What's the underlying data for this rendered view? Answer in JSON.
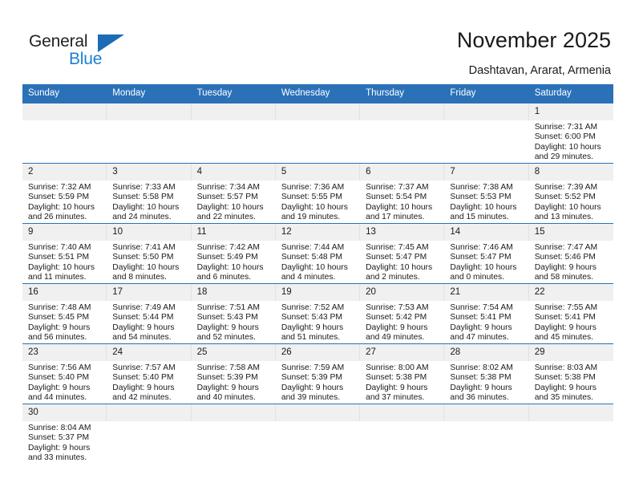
{
  "brand": {
    "name_top": "General",
    "name_bottom": "Blue",
    "triangle_color": "#1c6cb5",
    "blue_color": "#1c7fd6"
  },
  "header": {
    "title": "November 2025",
    "subtitle": "Dashtavan, Ararat, Armenia"
  },
  "theme": {
    "header_bg": "#2b71b8",
    "header_text": "#ffffff",
    "daynum_bg": "#f0f0f0",
    "row_divider": "#2b71b8",
    "body_text": "#1a1a1a"
  },
  "weekdays": [
    "Sunday",
    "Monday",
    "Tuesday",
    "Wednesday",
    "Thursday",
    "Friday",
    "Saturday"
  ],
  "labels": {
    "sunrise": "Sunrise:",
    "sunset": "Sunset:",
    "daylight": "Daylight:"
  },
  "weeks": [
    [
      {
        "day": ""
      },
      {
        "day": ""
      },
      {
        "day": ""
      },
      {
        "day": ""
      },
      {
        "day": ""
      },
      {
        "day": ""
      },
      {
        "day": "1",
        "sunrise": "Sunrise: 7:31 AM",
        "sunset": "Sunset: 6:00 PM",
        "daylight_line1": "Daylight: 10 hours",
        "daylight_line2": "and 29 minutes."
      }
    ],
    [
      {
        "day": "2",
        "sunrise": "Sunrise: 7:32 AM",
        "sunset": "Sunset: 5:59 PM",
        "daylight_line1": "Daylight: 10 hours",
        "daylight_line2": "and 26 minutes."
      },
      {
        "day": "3",
        "sunrise": "Sunrise: 7:33 AM",
        "sunset": "Sunset: 5:58 PM",
        "daylight_line1": "Daylight: 10 hours",
        "daylight_line2": "and 24 minutes."
      },
      {
        "day": "4",
        "sunrise": "Sunrise: 7:34 AM",
        "sunset": "Sunset: 5:57 PM",
        "daylight_line1": "Daylight: 10 hours",
        "daylight_line2": "and 22 minutes."
      },
      {
        "day": "5",
        "sunrise": "Sunrise: 7:36 AM",
        "sunset": "Sunset: 5:55 PM",
        "daylight_line1": "Daylight: 10 hours",
        "daylight_line2": "and 19 minutes."
      },
      {
        "day": "6",
        "sunrise": "Sunrise: 7:37 AM",
        "sunset": "Sunset: 5:54 PM",
        "daylight_line1": "Daylight: 10 hours",
        "daylight_line2": "and 17 minutes."
      },
      {
        "day": "7",
        "sunrise": "Sunrise: 7:38 AM",
        "sunset": "Sunset: 5:53 PM",
        "daylight_line1": "Daylight: 10 hours",
        "daylight_line2": "and 15 minutes."
      },
      {
        "day": "8",
        "sunrise": "Sunrise: 7:39 AM",
        "sunset": "Sunset: 5:52 PM",
        "daylight_line1": "Daylight: 10 hours",
        "daylight_line2": "and 13 minutes."
      }
    ],
    [
      {
        "day": "9",
        "sunrise": "Sunrise: 7:40 AM",
        "sunset": "Sunset: 5:51 PM",
        "daylight_line1": "Daylight: 10 hours",
        "daylight_line2": "and 11 minutes."
      },
      {
        "day": "10",
        "sunrise": "Sunrise: 7:41 AM",
        "sunset": "Sunset: 5:50 PM",
        "daylight_line1": "Daylight: 10 hours",
        "daylight_line2": "and 8 minutes."
      },
      {
        "day": "11",
        "sunrise": "Sunrise: 7:42 AM",
        "sunset": "Sunset: 5:49 PM",
        "daylight_line1": "Daylight: 10 hours",
        "daylight_line2": "and 6 minutes."
      },
      {
        "day": "12",
        "sunrise": "Sunrise: 7:44 AM",
        "sunset": "Sunset: 5:48 PM",
        "daylight_line1": "Daylight: 10 hours",
        "daylight_line2": "and 4 minutes."
      },
      {
        "day": "13",
        "sunrise": "Sunrise: 7:45 AM",
        "sunset": "Sunset: 5:47 PM",
        "daylight_line1": "Daylight: 10 hours",
        "daylight_line2": "and 2 minutes."
      },
      {
        "day": "14",
        "sunrise": "Sunrise: 7:46 AM",
        "sunset": "Sunset: 5:47 PM",
        "daylight_line1": "Daylight: 10 hours",
        "daylight_line2": "and 0 minutes."
      },
      {
        "day": "15",
        "sunrise": "Sunrise: 7:47 AM",
        "sunset": "Sunset: 5:46 PM",
        "daylight_line1": "Daylight: 9 hours",
        "daylight_line2": "and 58 minutes."
      }
    ],
    [
      {
        "day": "16",
        "sunrise": "Sunrise: 7:48 AM",
        "sunset": "Sunset: 5:45 PM",
        "daylight_line1": "Daylight: 9 hours",
        "daylight_line2": "and 56 minutes."
      },
      {
        "day": "17",
        "sunrise": "Sunrise: 7:49 AM",
        "sunset": "Sunset: 5:44 PM",
        "daylight_line1": "Daylight: 9 hours",
        "daylight_line2": "and 54 minutes."
      },
      {
        "day": "18",
        "sunrise": "Sunrise: 7:51 AM",
        "sunset": "Sunset: 5:43 PM",
        "daylight_line1": "Daylight: 9 hours",
        "daylight_line2": "and 52 minutes."
      },
      {
        "day": "19",
        "sunrise": "Sunrise: 7:52 AM",
        "sunset": "Sunset: 5:43 PM",
        "daylight_line1": "Daylight: 9 hours",
        "daylight_line2": "and 51 minutes."
      },
      {
        "day": "20",
        "sunrise": "Sunrise: 7:53 AM",
        "sunset": "Sunset: 5:42 PM",
        "daylight_line1": "Daylight: 9 hours",
        "daylight_line2": "and 49 minutes."
      },
      {
        "day": "21",
        "sunrise": "Sunrise: 7:54 AM",
        "sunset": "Sunset: 5:41 PM",
        "daylight_line1": "Daylight: 9 hours",
        "daylight_line2": "and 47 minutes."
      },
      {
        "day": "22",
        "sunrise": "Sunrise: 7:55 AM",
        "sunset": "Sunset: 5:41 PM",
        "daylight_line1": "Daylight: 9 hours",
        "daylight_line2": "and 45 minutes."
      }
    ],
    [
      {
        "day": "23",
        "sunrise": "Sunrise: 7:56 AM",
        "sunset": "Sunset: 5:40 PM",
        "daylight_line1": "Daylight: 9 hours",
        "daylight_line2": "and 44 minutes."
      },
      {
        "day": "24",
        "sunrise": "Sunrise: 7:57 AM",
        "sunset": "Sunset: 5:40 PM",
        "daylight_line1": "Daylight: 9 hours",
        "daylight_line2": "and 42 minutes."
      },
      {
        "day": "25",
        "sunrise": "Sunrise: 7:58 AM",
        "sunset": "Sunset: 5:39 PM",
        "daylight_line1": "Daylight: 9 hours",
        "daylight_line2": "and 40 minutes."
      },
      {
        "day": "26",
        "sunrise": "Sunrise: 7:59 AM",
        "sunset": "Sunset: 5:39 PM",
        "daylight_line1": "Daylight: 9 hours",
        "daylight_line2": "and 39 minutes."
      },
      {
        "day": "27",
        "sunrise": "Sunrise: 8:00 AM",
        "sunset": "Sunset: 5:38 PM",
        "daylight_line1": "Daylight: 9 hours",
        "daylight_line2": "and 37 minutes."
      },
      {
        "day": "28",
        "sunrise": "Sunrise: 8:02 AM",
        "sunset": "Sunset: 5:38 PM",
        "daylight_line1": "Daylight: 9 hours",
        "daylight_line2": "and 36 minutes."
      },
      {
        "day": "29",
        "sunrise": "Sunrise: 8:03 AM",
        "sunset": "Sunset: 5:38 PM",
        "daylight_line1": "Daylight: 9 hours",
        "daylight_line2": "and 35 minutes."
      }
    ],
    [
      {
        "day": "30",
        "sunrise": "Sunrise: 8:04 AM",
        "sunset": "Sunset: 5:37 PM",
        "daylight_line1": "Daylight: 9 hours",
        "daylight_line2": "and 33 minutes."
      },
      {
        "day": ""
      },
      {
        "day": ""
      },
      {
        "day": ""
      },
      {
        "day": ""
      },
      {
        "day": ""
      },
      {
        "day": ""
      }
    ]
  ]
}
